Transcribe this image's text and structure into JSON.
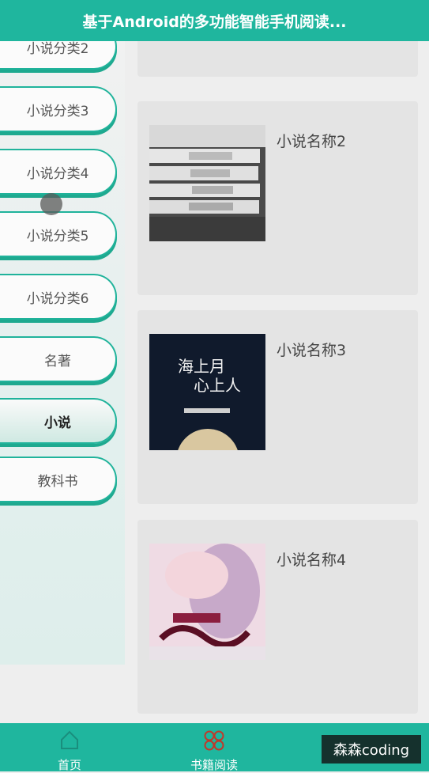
{
  "app": {
    "title": "基于Android的多功能智能手机阅读..."
  },
  "sidebar": {
    "categories": [
      {
        "label": "小说分类2"
      },
      {
        "label": "小说分类3"
      },
      {
        "label": "小说分类4"
      },
      {
        "label": "小说分类5"
      },
      {
        "label": "小说分类6"
      },
      {
        "label": "名著"
      },
      {
        "label": "小说",
        "selected": true
      },
      {
        "label": "教科书"
      }
    ]
  },
  "books": [
    {
      "name": "小说名称2",
      "cover_icon": "stacked-books-cover"
    },
    {
      "name": "小说名称3",
      "cover_icon": "night-moon-cover",
      "cover_text": "海上月 心上人"
    },
    {
      "name": "小说名称4",
      "cover_icon": "fantasy-heroine-cover"
    }
  ],
  "bottom_nav": {
    "items": [
      {
        "label": "首页",
        "icon": "home-icon"
      },
      {
        "label": "书籍阅读",
        "icon": "book-grid-icon"
      }
    ]
  },
  "watermark": {
    "text": "森森coding"
  },
  "colors": {
    "primary": "#1fb69e",
    "card": "#e4e4e4",
    "background": "#eeeeee"
  }
}
